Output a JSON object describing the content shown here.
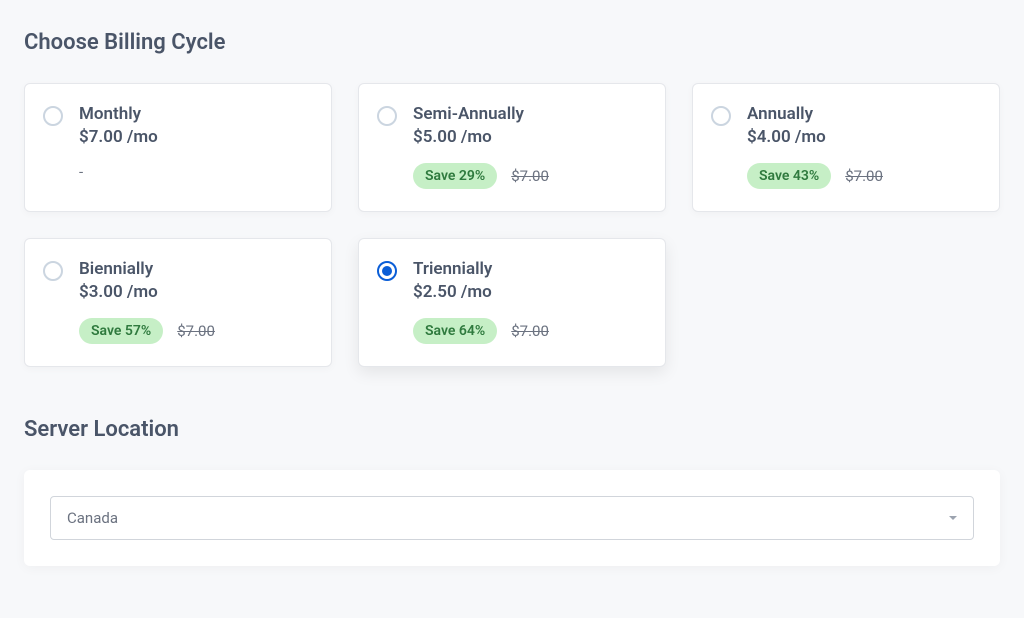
{
  "billing": {
    "title": "Choose Billing Cycle",
    "plans": [
      {
        "name": "Monthly",
        "price": "$7.00 /mo",
        "save": null,
        "old": null,
        "dash": "-",
        "selected": false
      },
      {
        "name": "Semi-Annually",
        "price": "$5.00 /mo",
        "save": "Save 29%",
        "old": "$7.00",
        "dash": null,
        "selected": false
      },
      {
        "name": "Annually",
        "price": "$4.00 /mo",
        "save": "Save 43%",
        "old": "$7.00",
        "dash": null,
        "selected": false
      },
      {
        "name": "Biennially",
        "price": "$3.00 /mo",
        "save": "Save 57%",
        "old": "$7.00",
        "dash": null,
        "selected": false
      },
      {
        "name": "Triennially",
        "price": "$2.50 /mo",
        "save": "Save 64%",
        "old": "$7.00",
        "dash": null,
        "selected": true
      }
    ]
  },
  "location": {
    "title": "Server Location",
    "selected": "Canada"
  }
}
